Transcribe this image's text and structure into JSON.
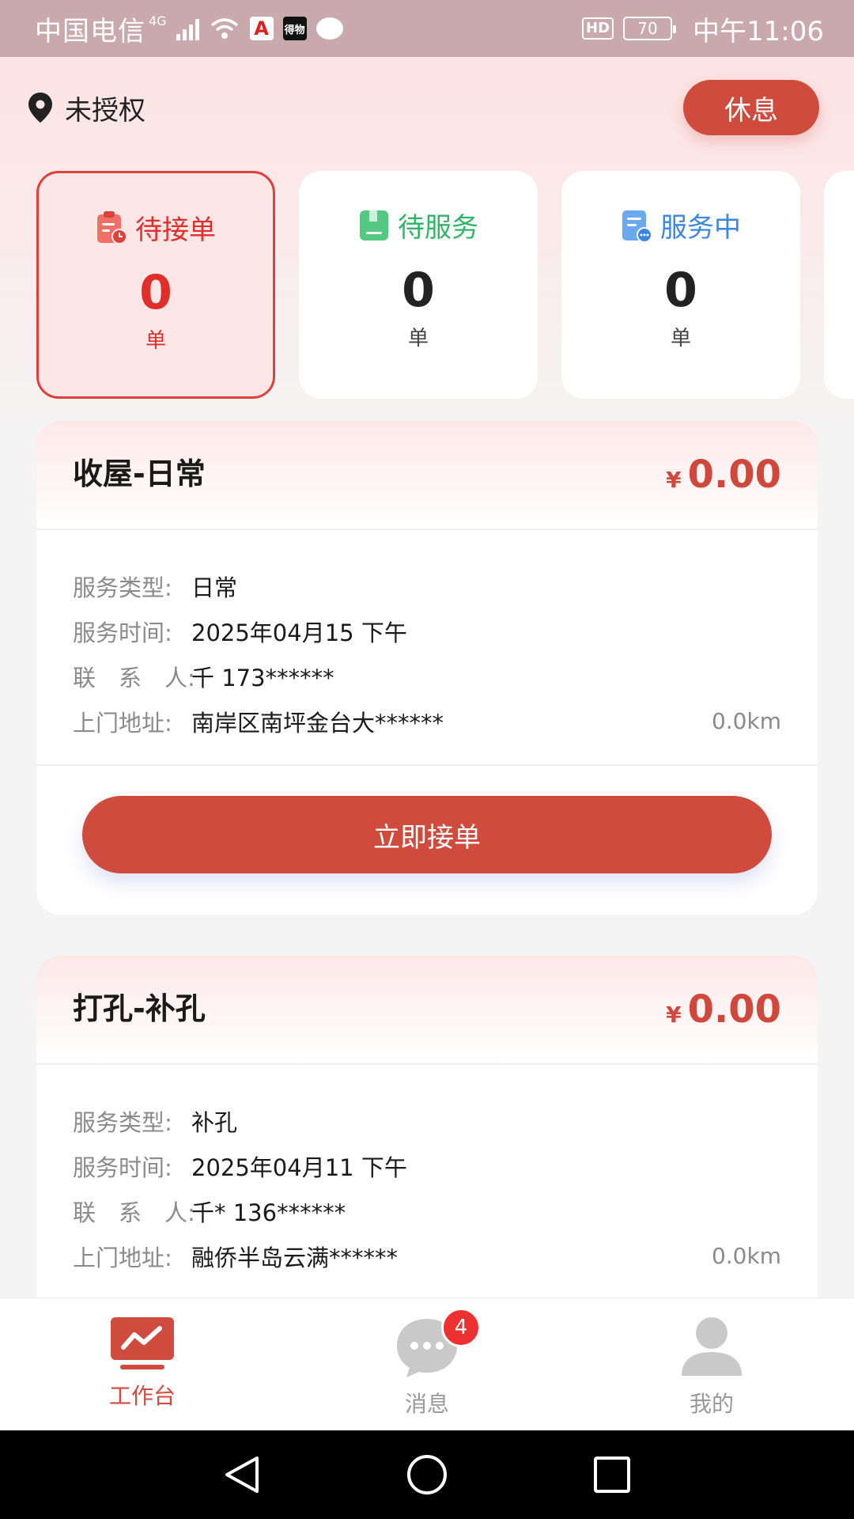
{
  "status_bar": {
    "carrier": "中国电信",
    "network": "4G",
    "app_badge_a": "A",
    "app_badge_b": "得物",
    "hd": "HD",
    "battery": "70",
    "time": "中午11:06"
  },
  "header": {
    "location_label": "未授权",
    "rest_button": "休息"
  },
  "stats": [
    {
      "label": "待接单",
      "value": "0",
      "unit": "单",
      "color": "#e02f2b",
      "icon": "pending-order-icon"
    },
    {
      "label": "待服务",
      "value": "0",
      "unit": "单",
      "color": "#2fb566",
      "icon": "to-serve-icon"
    },
    {
      "label": "服务中",
      "value": "0",
      "unit": "单",
      "color": "#3c86e0",
      "icon": "in-service-icon"
    }
  ],
  "labels": {
    "service_type": "服务类型:",
    "service_time": "服务时间:",
    "contact": "联　系　人:",
    "address": "上门地址:",
    "currency": "¥",
    "accept_button": "立即接单"
  },
  "orders": [
    {
      "title": "收屋-日常",
      "price": "0.00",
      "service_type": "日常",
      "service_time": "2025年04月15 下午",
      "contact": "千 173******",
      "address": "南岸区南坪金台大******",
      "distance": "0.0km"
    },
    {
      "title": "打孔-补孔",
      "price": "0.00",
      "service_type": "补孔",
      "service_time": "2025年04月11 下午",
      "contact": "千* 136******",
      "address": "融侨半岛云满******",
      "distance": "0.0km"
    }
  ],
  "tabs": [
    {
      "label": "工作台",
      "icon": "workbench-icon",
      "active": true
    },
    {
      "label": "消息",
      "icon": "message-icon",
      "badge": "4"
    },
    {
      "label": "我的",
      "icon": "profile-icon"
    }
  ],
  "colors": {
    "accent": "#cf4b3e",
    "pending": "#e02f2b",
    "to_serve": "#2fb566",
    "in_service": "#3c86e0"
  }
}
